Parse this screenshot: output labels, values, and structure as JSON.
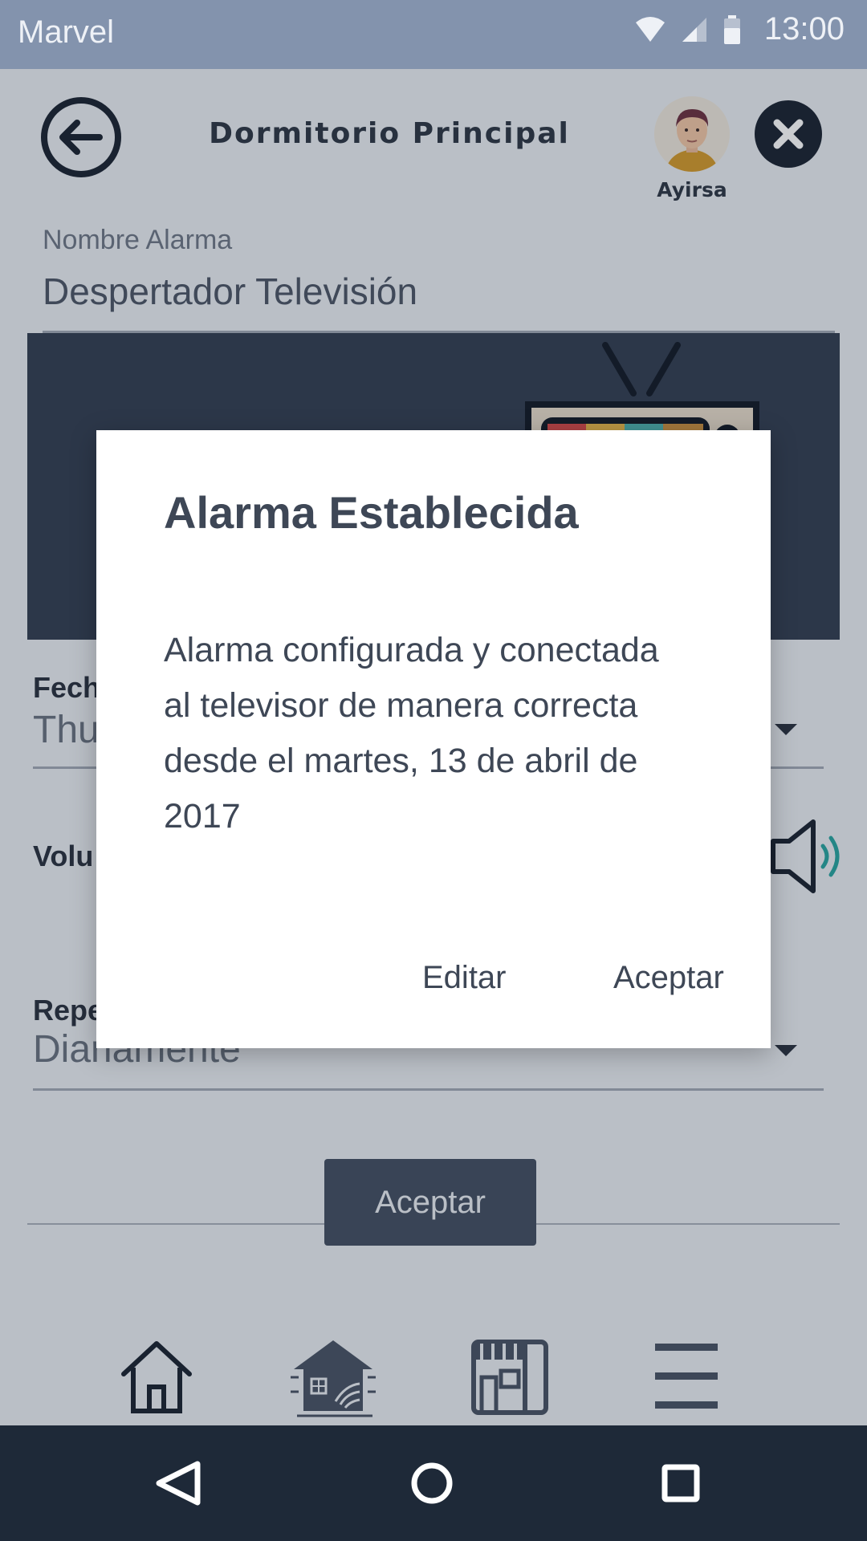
{
  "status_bar": {
    "carrier": "Marvel",
    "time": "13:00"
  },
  "header": {
    "title": "Dormitorio Principal",
    "user_name": "Ayirsa"
  },
  "form": {
    "alarm_name_label": "Nombre Alarma",
    "alarm_name_value": "Despertador Televisión",
    "date_label": "Fech",
    "date_value": "Thu",
    "volume_label": "Volu",
    "repeat_label": "Repe",
    "repeat_value": "Diariamente",
    "accept_label": "Aceptar"
  },
  "dialog": {
    "title": "Alarma Establecida",
    "message": "Alarma configurada y conectada al televisor de manera correcta desde el martes, 13 de abril de 2017",
    "edit_label": "Editar",
    "accept_label": "Aceptar"
  },
  "icons": {
    "back": "arrow-left-circle-icon",
    "close": "close-icon",
    "volume": "speaker-icon",
    "nav": [
      "home-icon",
      "smart-home-icon",
      "store-icon",
      "menu-icon"
    ],
    "system": [
      "back-triangle-icon",
      "home-circle-icon",
      "recents-square-icon"
    ]
  },
  "colors": {
    "scrim": "#1c2432",
    "accent": "#2aa5a1",
    "button": "#445063"
  }
}
